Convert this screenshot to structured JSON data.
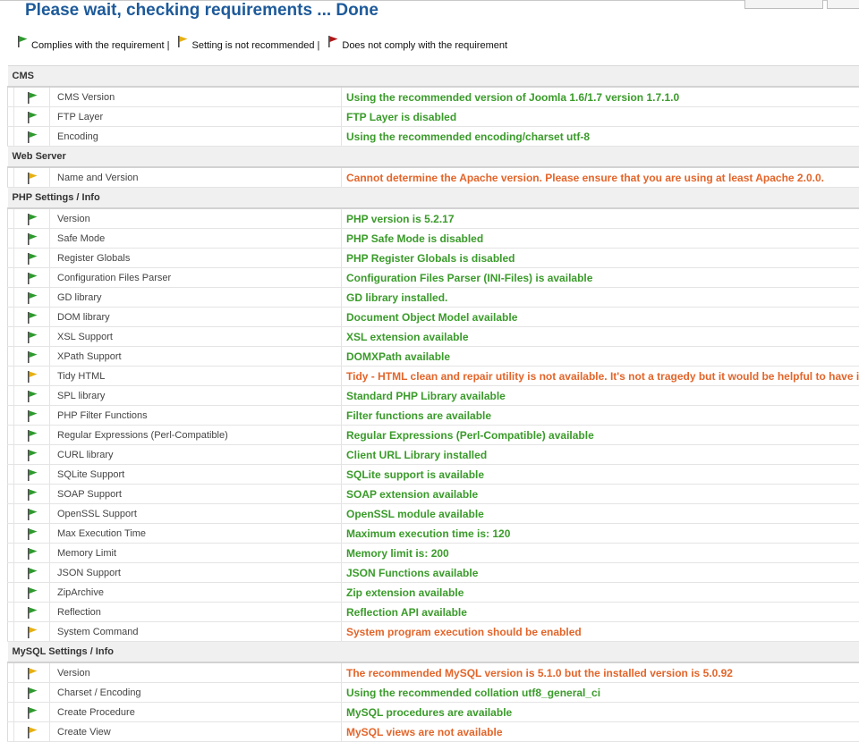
{
  "page": {
    "title": "Please wait, checking requirements ... Done"
  },
  "legend": [
    {
      "label": "Complies with the requirement |",
      "flag": "green-flag-icon",
      "color": "#2e9a2e"
    },
    {
      "label": "Setting is not recommended |",
      "flag": "yellow-flag-icon",
      "color": "#e6b012"
    },
    {
      "label": "Does not comply with the requirement",
      "flag": "red-flag-icon",
      "color": "#b01818"
    }
  ],
  "colors": {
    "title": "#1d5a9a",
    "ok_text": "#3a9b2a",
    "warn_text": "#e3652a",
    "section_bg": "#f0f0f0"
  },
  "sections": [
    {
      "title": "CMS",
      "rows": [
        {
          "name": "CMS Version",
          "message": "Using the recommended version of Joomla 1.6/1.7 version 1.7.1.0",
          "status": "ok"
        },
        {
          "name": "FTP Layer",
          "message": "FTP Layer is disabled",
          "status": "ok"
        },
        {
          "name": "Encoding",
          "message": "Using the recommended encoding/charset utf-8",
          "status": "ok"
        }
      ]
    },
    {
      "title": "Web Server",
      "rows": [
        {
          "name": "Name and Version",
          "message": "Cannot determine the Apache version. Please ensure that you are using at least Apache 2.0.0.",
          "status": "warn"
        }
      ]
    },
    {
      "title": "PHP Settings / Info",
      "rows": [
        {
          "name": "Version",
          "message": "PHP version is 5.2.17",
          "status": "ok"
        },
        {
          "name": "Safe Mode",
          "message": "PHP Safe Mode is disabled",
          "status": "ok"
        },
        {
          "name": "Register Globals",
          "message": "PHP Register Globals is disabled",
          "status": "ok"
        },
        {
          "name": "Configuration Files Parser",
          "message": "Configuration Files Parser (INI-Files) is available",
          "status": "ok"
        },
        {
          "name": "GD library",
          "message": "GD library installed.",
          "status": "ok"
        },
        {
          "name": "DOM library",
          "message": "Document Object Model available",
          "status": "ok"
        },
        {
          "name": "XSL Support",
          "message": "XSL extension available",
          "status": "ok"
        },
        {
          "name": "XPath Support",
          "message": "DOMXPath available",
          "status": "ok"
        },
        {
          "name": "Tidy HTML",
          "message": "Tidy - HTML clean and repair utility is not available. It's not a tragedy but it would be helpful to have it",
          "status": "warn"
        },
        {
          "name": "SPL library",
          "message": "Standard PHP Library available",
          "status": "ok"
        },
        {
          "name": "PHP Filter Functions",
          "message": "Filter functions are available",
          "status": "ok"
        },
        {
          "name": "Regular Expressions (Perl-Compatible)",
          "message": "Regular Expressions (Perl-Compatible) available",
          "status": "ok"
        },
        {
          "name": "CURL library",
          "message": "Client URL Library installed",
          "status": "ok"
        },
        {
          "name": "SQLite Support",
          "message": "SQLite support is available",
          "status": "ok"
        },
        {
          "name": "SOAP Support",
          "message": "SOAP extension available",
          "status": "ok"
        },
        {
          "name": "OpenSSL Support",
          "message": "OpenSSL module available",
          "status": "ok"
        },
        {
          "name": "Max Execution Time",
          "message": "Maximum execution time is: 120",
          "status": "ok"
        },
        {
          "name": "Memory Limit",
          "message": "Memory limit is: 200",
          "status": "ok"
        },
        {
          "name": "JSON Support",
          "message": "JSON Functions available",
          "status": "ok"
        },
        {
          "name": "ZipArchive",
          "message": "Zip extension available",
          "status": "ok"
        },
        {
          "name": "Reflection",
          "message": "Reflection API available",
          "status": "ok"
        },
        {
          "name": "System Command",
          "message": "System program execution should be enabled",
          "status": "warn"
        }
      ]
    },
    {
      "title": "MySQL Settings / Info",
      "rows": [
        {
          "name": "Version",
          "message": "The recommended MySQL version is 5.1.0 but the installed version is 5.0.92",
          "status": "warn"
        },
        {
          "name": "Charset / Encoding",
          "message": "Using the recommended collation utf8_general_ci",
          "status": "ok"
        },
        {
          "name": "Create Procedure",
          "message": "MySQL procedures are available",
          "status": "ok"
        },
        {
          "name": "Create View",
          "message": "MySQL views are not available",
          "status": "warn"
        }
      ]
    }
  ]
}
